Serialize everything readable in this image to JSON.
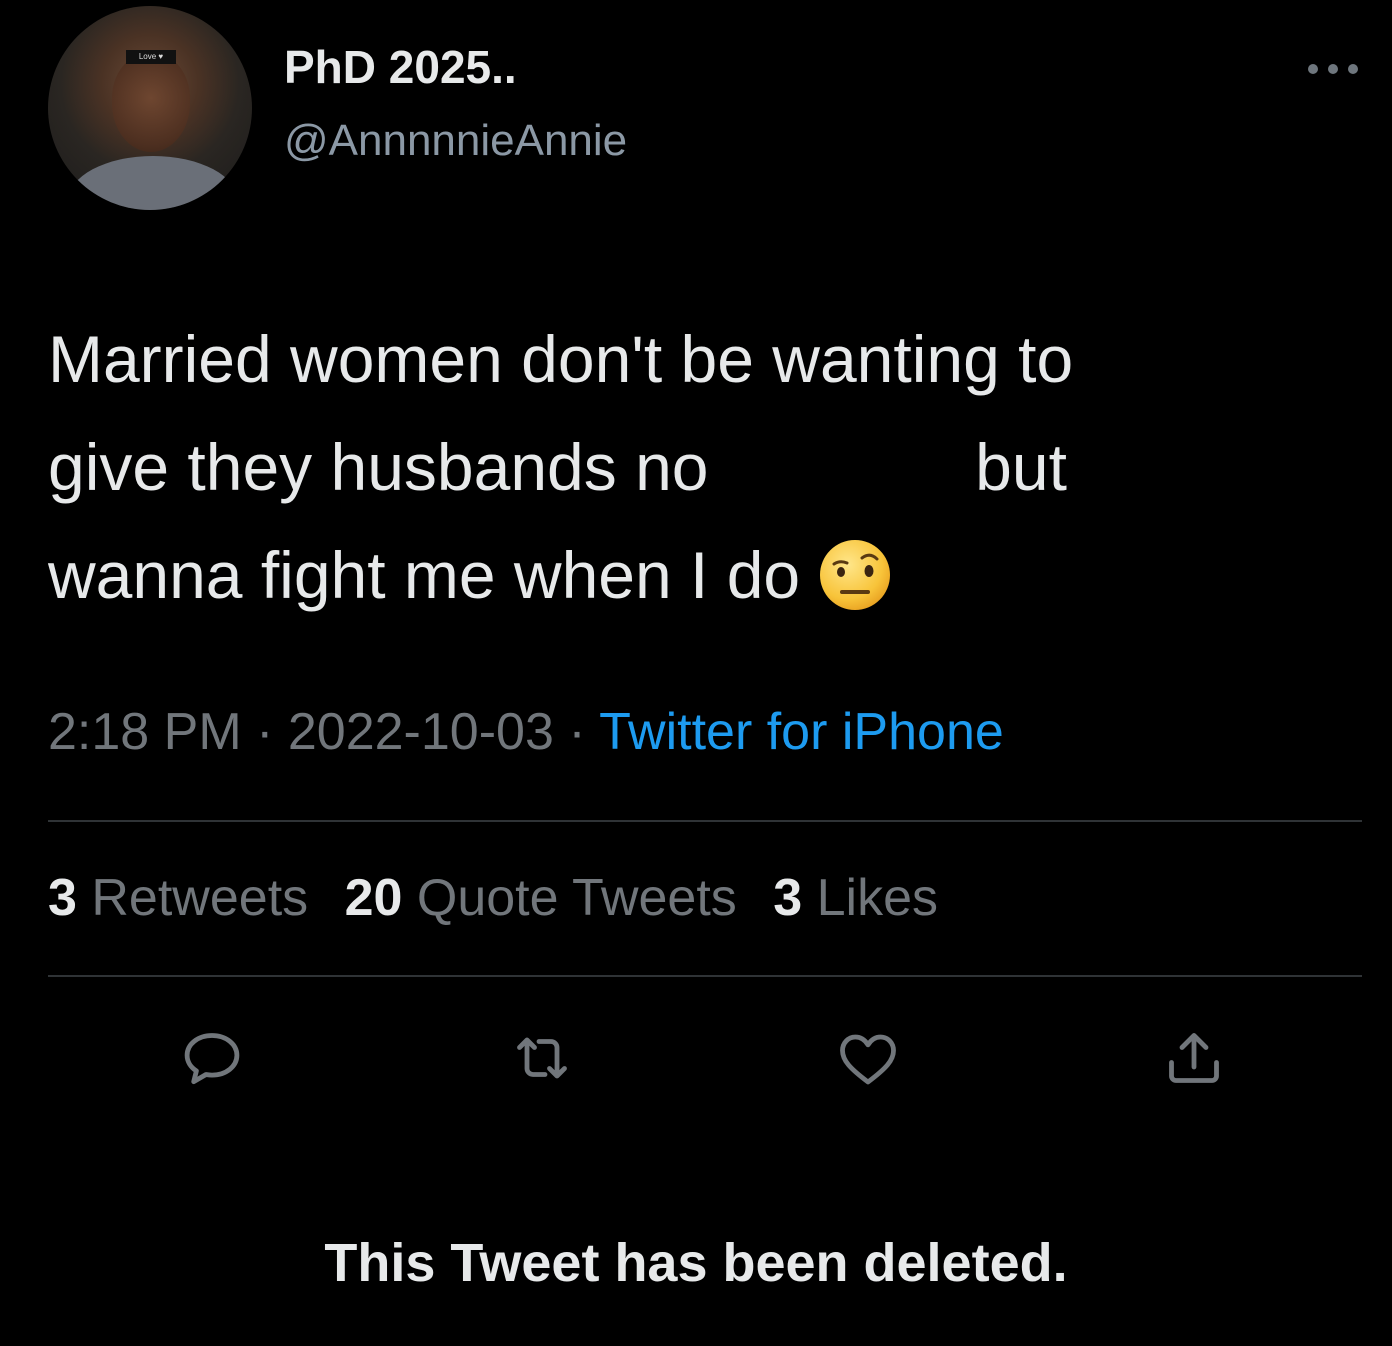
{
  "user": {
    "display_name": "PhD 2025..",
    "handle": "@AnnnnnieAnnie",
    "avatar_badge": "Love ♥"
  },
  "tweet": {
    "line1": "Married women don't be wanting to",
    "line2_start": "give they husbands no",
    "line2_end": "but",
    "line3": "wanna fight me when I do",
    "emoji": "face-with-raised-eyebrow"
  },
  "meta": {
    "time": "2:18 PM",
    "separator": " · ",
    "date": "2022-10-03",
    "source": "Twitter for iPhone"
  },
  "stats": {
    "retweets_count": "3",
    "retweets_label": "Retweets",
    "quotes_count": "20",
    "quotes_label": "Quote Tweets",
    "likes_count": "3",
    "likes_label": "Likes"
  },
  "actions": {
    "reply_icon": "reply-icon",
    "retweet_icon": "retweet-icon",
    "like_icon": "heart-icon",
    "share_icon": "share-icon"
  },
  "notice": "This Tweet has been deleted.",
  "colors": {
    "background": "#000000",
    "text": "#e7e9ea",
    "secondary": "#71767b",
    "link": "#1d9bf0",
    "divider": "#2f3336"
  }
}
